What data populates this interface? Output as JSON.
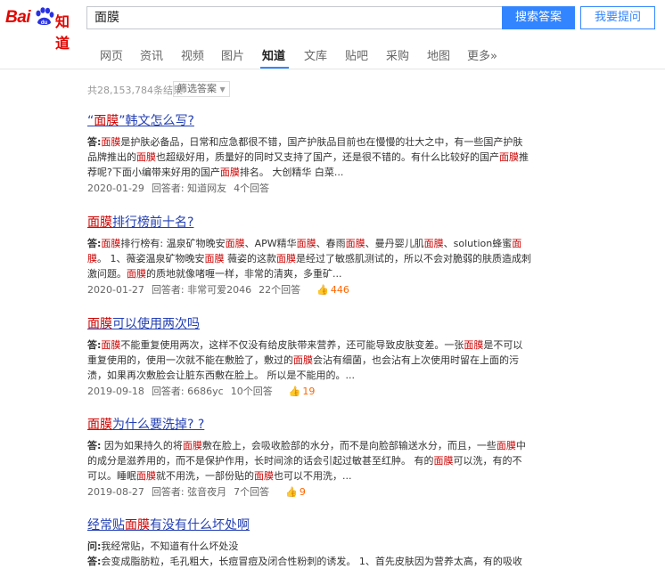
{
  "logo": {
    "bai": "Bai",
    "zhidao": "知道"
  },
  "search": {
    "value": "面膜",
    "button": "搜索答案",
    "ask": "我要提问"
  },
  "nav": [
    {
      "label": "网页",
      "active": false
    },
    {
      "label": "资讯",
      "active": false
    },
    {
      "label": "视频",
      "active": false
    },
    {
      "label": "图片",
      "active": false
    },
    {
      "label": "知道",
      "active": true
    },
    {
      "label": "文库",
      "active": false
    },
    {
      "label": "贴吧",
      "active": false
    },
    {
      "label": "采购",
      "active": false
    },
    {
      "label": "地图",
      "active": false
    },
    {
      "label": "更多»",
      "active": false
    }
  ],
  "stats": "共28,153,784条结果",
  "filter": "筛选答案",
  "results": [
    {
      "title_parts": [
        [
          "“",
          false
        ],
        [
          "面膜",
          true
        ],
        [
          "”韩文怎么写?",
          false
        ]
      ],
      "abstract_lines": [
        [
          [
            "答:",
            "b"
          ],
          [
            "面膜",
            "h"
          ],
          [
            "是护肤必备品，日常和应急都很不错，国产护肤品目前也在慢慢的壮大之中，有一些国产护肤",
            ""
          ]
        ],
        [
          [
            "品牌推出的",
            ""
          ],
          [
            "面膜",
            "h"
          ],
          [
            "也超级好用，质量好的同时又支持了国产，还是很不错的。有什么比较好的国产",
            ""
          ],
          [
            "面膜",
            "h"
          ],
          [
            "推",
            ""
          ]
        ],
        [
          [
            "荐呢?下面小编带来好用的国产",
            ""
          ],
          [
            "面膜",
            "h"
          ],
          [
            "排名。 大创精华 白菜...",
            ""
          ]
        ]
      ],
      "date": "2020-01-29",
      "answerer": "回答者: 知道网友",
      "answers": "4个回答",
      "likes": ""
    },
    {
      "title_parts": [
        [
          "面膜",
          true
        ],
        [
          "排行榜前十名?",
          false
        ]
      ],
      "abstract_lines": [
        [
          [
            "答:",
            "b"
          ],
          [
            "面膜",
            "h"
          ],
          [
            "排行榜有: 温泉矿物晚安",
            ""
          ],
          [
            "面膜",
            "h"
          ],
          [
            "、APW精华",
            ""
          ],
          [
            "面膜",
            "h"
          ],
          [
            "、春雨",
            ""
          ],
          [
            "面膜",
            "h"
          ],
          [
            "、曼丹婴儿肌",
            ""
          ],
          [
            "面膜",
            "h"
          ],
          [
            "、solution蜂蜜",
            ""
          ],
          [
            "面",
            "h"
          ]
        ],
        [
          [
            "膜",
            "h"
          ],
          [
            "。 1、薇姿温泉矿物晚安",
            ""
          ],
          [
            "面膜",
            "h"
          ],
          [
            " 薇姿的这款",
            ""
          ],
          [
            "面膜",
            "h"
          ],
          [
            "是经过了敏感肌测试的，所以不会对脆弱的肤质造成刺",
            ""
          ]
        ],
        [
          [
            "激问题。",
            ""
          ],
          [
            "面膜",
            "h"
          ],
          [
            "的质地就像啫喱一样，非常的清爽，多重矿...",
            ""
          ]
        ]
      ],
      "date": "2020-01-27",
      "answerer": "回答者: 非常可爱2046",
      "answers": "22个回答",
      "likes": "446"
    },
    {
      "title_parts": [
        [
          "面膜",
          true
        ],
        [
          "可以使用两次吗",
          false
        ]
      ],
      "abstract_lines": [
        [
          [
            "答:",
            "b"
          ],
          [
            "面膜",
            "h"
          ],
          [
            "不能重复使用两次，这样不仅没有给皮肤带来营养，还可能导致皮肤变差。一张",
            ""
          ],
          [
            "面膜",
            "h"
          ],
          [
            "是不可以",
            ""
          ]
        ],
        [
          [
            "重复使用的，使用一次就不能在敷脸了，敷过的",
            ""
          ],
          [
            "面膜",
            "h"
          ],
          [
            "会沾有细菌，也会沾有上次使用时留在上面的污",
            ""
          ]
        ],
        [
          [
            "渍，如果再次敷脸会让脏东西敷在脸上。 所以是不能用的。...",
            ""
          ]
        ]
      ],
      "date": "2019-09-18",
      "answerer": "回答者: 6686yc",
      "answers": "10个回答",
      "likes": "19"
    },
    {
      "title_parts": [
        [
          "面膜",
          true
        ],
        [
          "为什么要洗掉? ?",
          false
        ]
      ],
      "abstract_lines": [
        [
          [
            "答:",
            "b"
          ],
          [
            " 因为如果持久的将",
            ""
          ],
          [
            "面膜",
            "h"
          ],
          [
            "敷在脸上，会吸收脸部的水分，而不是向脸部输送水分，而且，一些",
            ""
          ],
          [
            "面膜",
            "h"
          ],
          [
            "中",
            ""
          ]
        ],
        [
          [
            "的成分是滋养用的，而不是保护作用，长时间涂的话会引起过敏甚至红肿。 有的",
            ""
          ],
          [
            "面膜",
            "h"
          ],
          [
            "可以洗，有的不",
            ""
          ]
        ],
        [
          [
            "可以。睡眠",
            ""
          ],
          [
            "面膜",
            "h"
          ],
          [
            "就不用洗，一部份贴的",
            ""
          ],
          [
            "面膜",
            "h"
          ],
          [
            "也可以不用洗，...",
            ""
          ]
        ]
      ],
      "date": "2019-08-27",
      "answerer": "回答者: 弦音夜月",
      "answers": "7个回答",
      "likes": "9"
    },
    {
      "title_parts": [
        [
          "经常贴",
          false
        ],
        [
          "面膜",
          true
        ],
        [
          "有没有什么坏处啊",
          false
        ]
      ],
      "abstract_lines": [
        [
          [
            "问:",
            "b"
          ],
          [
            "我经常贴，不知道有什么坏处没",
            ""
          ]
        ],
        [
          [
            "答:",
            "b"
          ],
          [
            "会变成脂肪粒，毛孔粗大，长痘冒痘及闭合性粉刺的诱发。 1、首先皮肤因为营养太高，有的吸收",
            ""
          ]
        ]
      ],
      "date": "",
      "answerer": "",
      "answers": "",
      "likes": ""
    }
  ]
}
